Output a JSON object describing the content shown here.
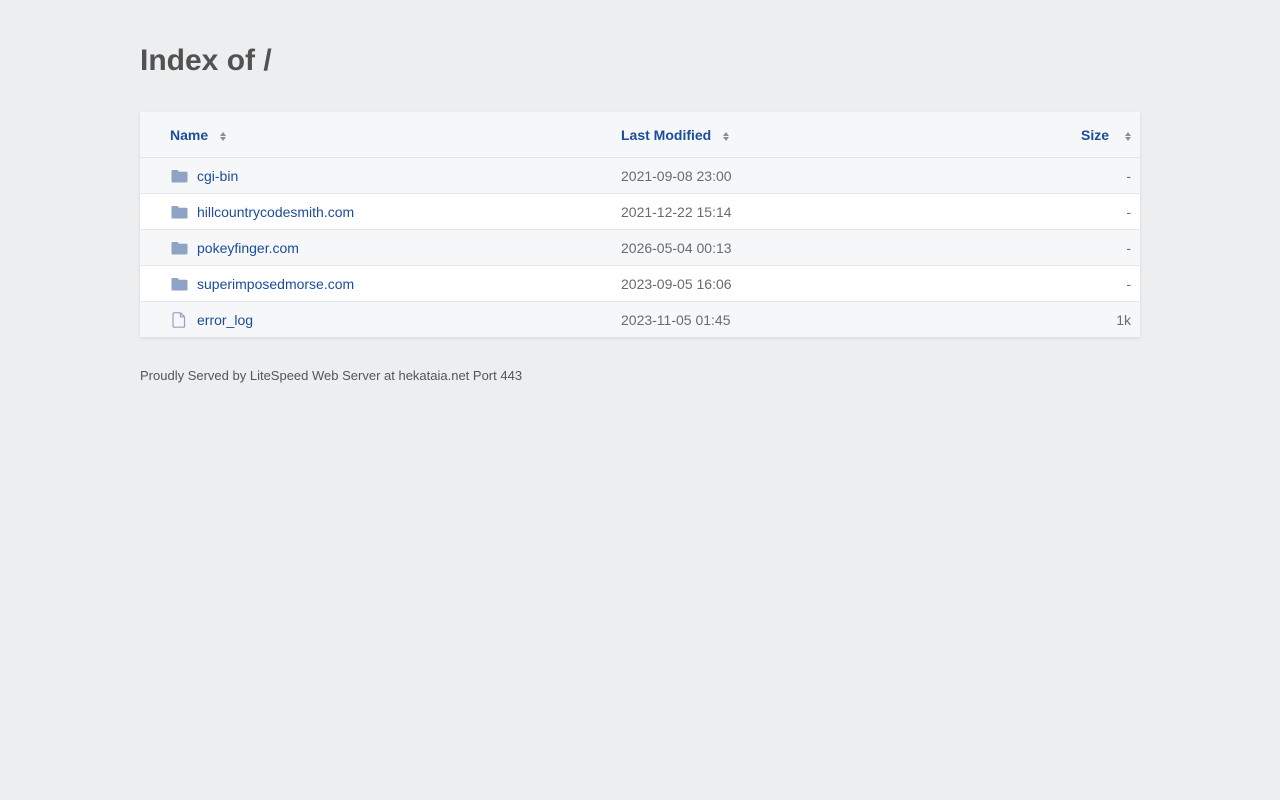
{
  "page": {
    "title": "Index of /",
    "footer": "Proudly Served by LiteSpeed Web Server at hekataia.net Port 443"
  },
  "table": {
    "columns": {
      "name": "Name",
      "modified": "Last Modified",
      "size": "Size"
    },
    "rows": [
      {
        "name": "cgi-bin",
        "modified": "2021-09-08 23:00",
        "size": "-",
        "icon": "folder-icon"
      },
      {
        "name": "hillcountrycodesmith.com",
        "modified": "2021-12-22 15:14",
        "size": "-",
        "icon": "folder-icon"
      },
      {
        "name": "pokeyfinger.com",
        "modified": "2026-05-04 00:13",
        "size": "-",
        "icon": "folder-icon"
      },
      {
        "name": "superimposedmorse.com",
        "modified": "2023-09-05 16:06",
        "size": "-",
        "icon": "folder-icon"
      },
      {
        "name": "error_log",
        "modified": "2023-11-05 01:45",
        "size": "1k",
        "icon": "file-icon"
      }
    ]
  },
  "colors": {
    "link": "#1c4c9a",
    "background": "#eceef0",
    "folder_icon": "#8fa3c4"
  }
}
